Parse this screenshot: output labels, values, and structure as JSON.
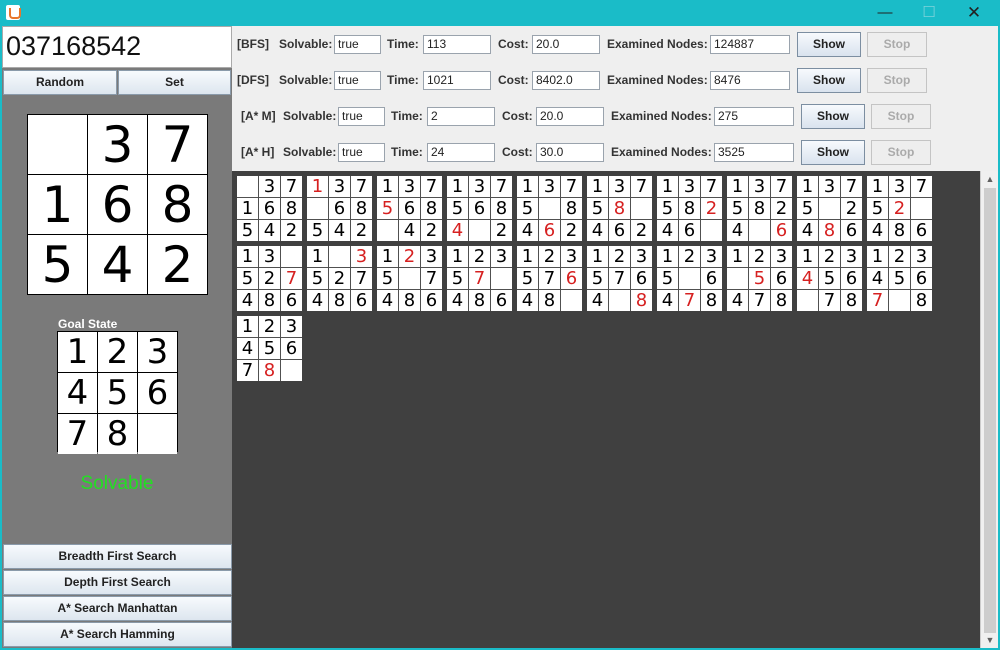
{
  "window": {
    "minimize": "—",
    "maximize": "☐",
    "close": "✕"
  },
  "input": {
    "value": "037168542"
  },
  "buttons": {
    "random": "Random",
    "set": "Set"
  },
  "start_state": [
    0,
    3,
    7,
    1,
    6,
    8,
    5,
    4,
    2
  ],
  "goal_label": "Goal State",
  "goal_state": [
    1,
    2,
    3,
    4,
    5,
    6,
    7,
    8,
    0
  ],
  "status": {
    "text": "Solvable",
    "color": "#22e022"
  },
  "field_labels": {
    "solvable": "Solvable:",
    "time": "Time:",
    "cost": "Cost:",
    "examined": "Examined Nodes:"
  },
  "results": [
    {
      "tag": "[BFS]",
      "solvable": "true",
      "time": "113",
      "cost": "20.0",
      "examined": "124887",
      "show": "Show",
      "stop": "Stop"
    },
    {
      "tag": "[DFS]",
      "solvable": "true",
      "time": "1021",
      "cost": "8402.0",
      "examined": "8476",
      "show": "Show",
      "stop": "Stop"
    },
    {
      "tag": "[A* M]",
      "solvable": "true",
      "time": "2",
      "cost": "20.0",
      "examined": "275",
      "show": "Show",
      "stop": "Stop"
    },
    {
      "tag": "[A* H]",
      "solvable": "true",
      "time": "24",
      "cost": "30.0",
      "examined": "3525",
      "show": "Show",
      "stop": "Stop"
    }
  ],
  "algorithms": [
    "Breadth First Search",
    "Depth First Search",
    "A* Search Manhattan",
    "A* Search Hamming"
  ],
  "solution_path": [
    {
      "board": [
        0,
        3,
        7,
        1,
        6,
        8,
        5,
        4,
        2
      ],
      "moved": -1
    },
    {
      "board": [
        1,
        3,
        7,
        0,
        6,
        8,
        5,
        4,
        2
      ],
      "moved": 0
    },
    {
      "board": [
        1,
        3,
        7,
        5,
        6,
        8,
        0,
        4,
        2
      ],
      "moved": 3
    },
    {
      "board": [
        1,
        3,
        7,
        5,
        6,
        8,
        4,
        0,
        2
      ],
      "moved": 6
    },
    {
      "board": [
        1,
        3,
        7,
        5,
        0,
        8,
        4,
        6,
        2
      ],
      "moved": 7
    },
    {
      "board": [
        1,
        3,
        7,
        5,
        8,
        0,
        4,
        6,
        2
      ],
      "moved": 4
    },
    {
      "board": [
        1,
        3,
        7,
        5,
        8,
        2,
        4,
        6,
        0
      ],
      "moved": 5
    },
    {
      "board": [
        1,
        3,
        7,
        5,
        8,
        2,
        4,
        0,
        6
      ],
      "moved": 8
    },
    {
      "board": [
        1,
        3,
        7,
        5,
        0,
        2,
        4,
        8,
        6
      ],
      "moved": 7
    },
    {
      "board": [
        1,
        3,
        7,
        5,
        2,
        0,
        4,
        8,
        6
      ],
      "moved": 4
    },
    {
      "board": [
        1,
        3,
        0,
        5,
        2,
        7,
        4,
        8,
        6
      ],
      "moved": 5
    },
    {
      "board": [
        1,
        0,
        3,
        5,
        2,
        7,
        4,
        8,
        6
      ],
      "moved": 2
    },
    {
      "board": [
        1,
        2,
        3,
        5,
        0,
        7,
        4,
        8,
        6
      ],
      "moved": 1
    },
    {
      "board": [
        1,
        2,
        3,
        5,
        7,
        0,
        4,
        8,
        6
      ],
      "moved": 4
    },
    {
      "board": [
        1,
        2,
        3,
        5,
        7,
        6,
        4,
        8,
        0
      ],
      "moved": 5
    },
    {
      "board": [
        1,
        2,
        3,
        5,
        7,
        6,
        4,
        0,
        8
      ],
      "moved": 8
    },
    {
      "board": [
        1,
        2,
        3,
        5,
        0,
        6,
        4,
        7,
        8
      ],
      "moved": 7
    },
    {
      "board": [
        1,
        2,
        3,
        0,
        5,
        6,
        4,
        7,
        8
      ],
      "moved": 4
    },
    {
      "board": [
        1,
        2,
        3,
        4,
        5,
        6,
        0,
        7,
        8
      ],
      "moved": 3
    },
    {
      "board": [
        1,
        2,
        3,
        4,
        5,
        6,
        7,
        0,
        8
      ],
      "moved": 6
    },
    {
      "board": [
        1,
        2,
        3,
        4,
        5,
        6,
        7,
        8,
        0
      ],
      "moved": 7
    }
  ],
  "scrollbar": {
    "up": "▲",
    "down": "▼"
  }
}
